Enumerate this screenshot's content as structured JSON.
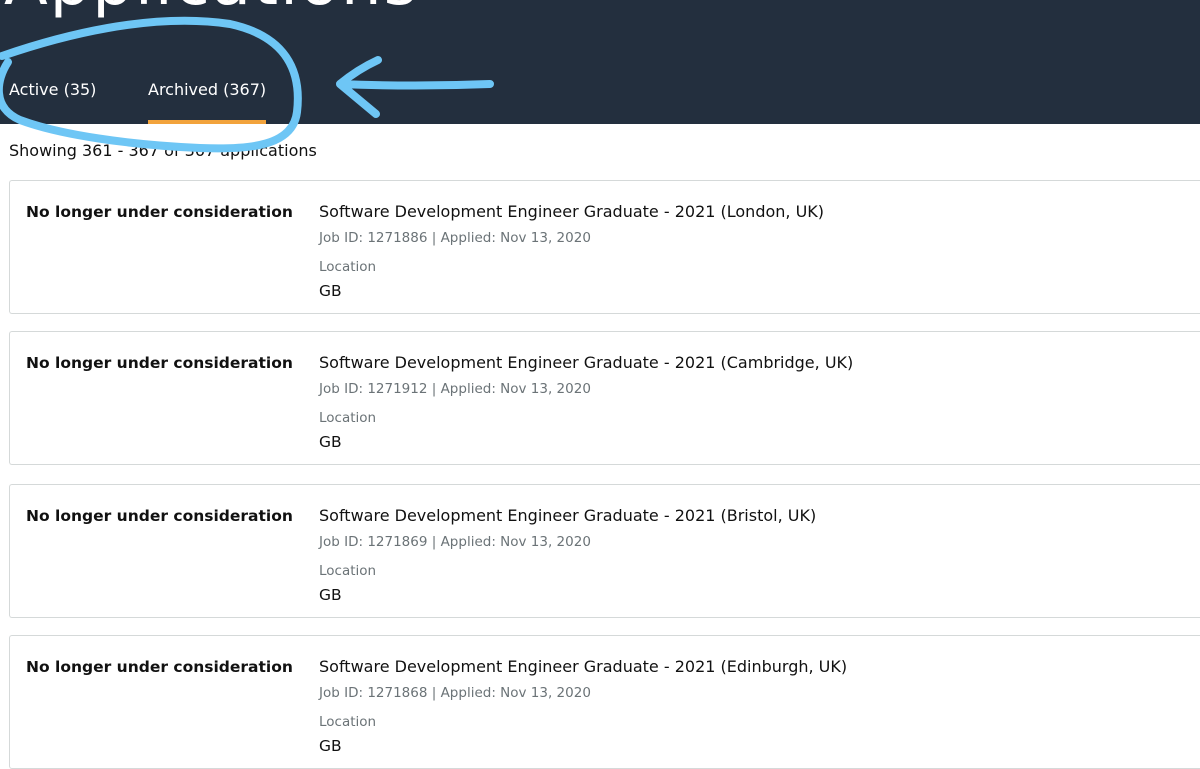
{
  "header": {
    "title": "Applications",
    "tabs": [
      {
        "label": "Active (35)"
      },
      {
        "label": "Archived (367)"
      }
    ],
    "active_tab_color": "#f2a33c",
    "background_color": "#232f3e"
  },
  "annotation": {
    "color": "#6ec6f5"
  },
  "results": {
    "showing_text": "Showing 361 - 367 of 367 applications"
  },
  "applications": [
    {
      "status": "No longer under consideration",
      "title": "Software Development Engineer Graduate - 2021 (London, UK)",
      "meta": "Job ID: 1271886 | Applied: Nov 13, 2020",
      "location_label": "Location",
      "location": "GB"
    },
    {
      "status": "No longer under consideration",
      "title": "Software Development Engineer Graduate - 2021 (Cambridge, UK)",
      "meta": "Job ID: 1271912 | Applied: Nov 13, 2020",
      "location_label": "Location",
      "location": "GB"
    },
    {
      "status": "No longer under consideration",
      "title": "Software Development Engineer Graduate - 2021 (Bristol, UK)",
      "meta": "Job ID: 1271869 | Applied: Nov 13, 2020",
      "location_label": "Location",
      "location": "GB"
    },
    {
      "status": "No longer under consideration",
      "title": "Software Development Engineer Graduate - 2021 (Edinburgh, UK)",
      "meta": "Job ID: 1271868 | Applied: Nov 13, 2020",
      "location_label": "Location",
      "location": "GB"
    }
  ]
}
